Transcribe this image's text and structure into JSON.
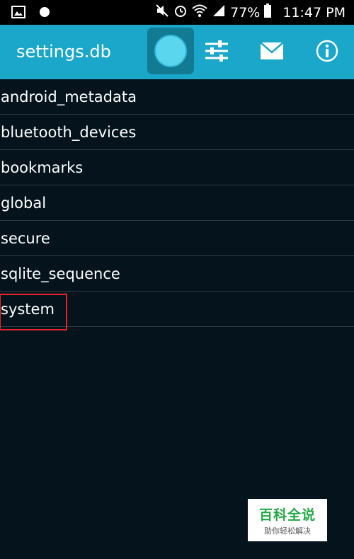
{
  "status_bar": {
    "battery": "77%",
    "time": "11:47 PM",
    "icons": [
      "gallery-icon",
      "record-icon",
      "mute-icon",
      "alarm-icon",
      "wifi-icon",
      "signal-icon",
      "battery-icon"
    ]
  },
  "toolbar": {
    "title": "settings.db",
    "buttons": [
      "fab-circle-icon",
      "sliders-icon",
      "mail-icon",
      "info-icon"
    ],
    "accent_color": "#1aa7c9"
  },
  "list": {
    "items": [
      {
        "label": "android_metadata"
      },
      {
        "label": "bluetooth_devices"
      },
      {
        "label": "bookmarks"
      },
      {
        "label": "global"
      },
      {
        "label": "secure"
      },
      {
        "label": "sqlite_sequence"
      },
      {
        "label": "system"
      }
    ],
    "highlighted_item": "system",
    "highlight_color": "#e6232a"
  },
  "watermark": {
    "title": "百科全说",
    "subtitle": "助你轻松解决"
  }
}
